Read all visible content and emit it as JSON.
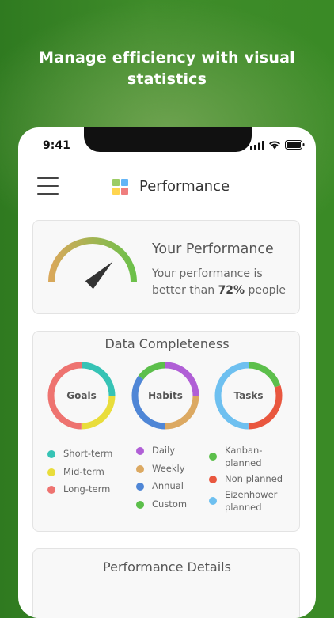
{
  "headline": {
    "line1": "Manage efficiency with visual",
    "line2": "statistics"
  },
  "status_bar": {
    "time": "9:41",
    "icons": [
      "cellular-signal",
      "wifi",
      "battery"
    ]
  },
  "nav": {
    "title": "Performance",
    "menu_icon": "hamburger-menu",
    "logo_icon": "four-squares-logo",
    "logo_colors": [
      "#9ccc65",
      "#64b5f6",
      "#ffd54f",
      "#ef7e7e"
    ]
  },
  "performance": {
    "title": "Your Performance",
    "text_before": "Your performance is better than ",
    "percent": "72%",
    "text_after": " people",
    "gauge_value": 0.75,
    "gauge_colors": [
      "#d9a85a",
      "#6cc04a"
    ]
  },
  "completeness": {
    "title": "Data Completeness",
    "charts": [
      {
        "label": "Goals",
        "segments": [
          {
            "name": "Short-term",
            "color": "#36c3b5",
            "value": 25
          },
          {
            "name": "Mid-term",
            "color": "#e9dd3b",
            "value": 25
          },
          {
            "name": "Long-term",
            "color": "#ee7370",
            "value": 50
          }
        ]
      },
      {
        "label": "Habits",
        "segments": [
          {
            "name": "Daily",
            "color": "#b05fd6",
            "value": 25
          },
          {
            "name": "Weekly",
            "color": "#dca962",
            "value": 25
          },
          {
            "name": "Annual",
            "color": "#4f86d6",
            "value": 35
          },
          {
            "name": "Custom",
            "color": "#5cbf4b",
            "value": 15
          }
        ]
      },
      {
        "label": "Tasks",
        "segments": [
          {
            "name": "Kanban-planned",
            "color": "#5cbf4b",
            "value": 20
          },
          {
            "name": "Non planned",
            "color": "#e9573f",
            "value": 30
          },
          {
            "name": "Eizenhower planned",
            "color": "#6ec0f0",
            "value": 50
          }
        ]
      }
    ],
    "legends": [
      [
        {
          "label": "Short-term",
          "color": "#36c3b5"
        },
        {
          "label": "Mid-term",
          "color": "#e9dd3b"
        },
        {
          "label": "Long-term",
          "color": "#ee7370"
        }
      ],
      [
        {
          "label": "Daily",
          "color": "#b05fd6"
        },
        {
          "label": "Weekly",
          "color": "#dca962"
        },
        {
          "label": "Annual",
          "color": "#4f86d6"
        },
        {
          "label": "Custom",
          "color": "#5cbf4b"
        }
      ],
      [
        {
          "label": "Kanban-planned",
          "color": "#5cbf4b"
        },
        {
          "label": "Non planned",
          "color": "#e9573f"
        },
        {
          "label": "Eizenhower planned",
          "color": "#6ec0f0"
        }
      ]
    ]
  },
  "details": {
    "title": "Performance Details"
  }
}
